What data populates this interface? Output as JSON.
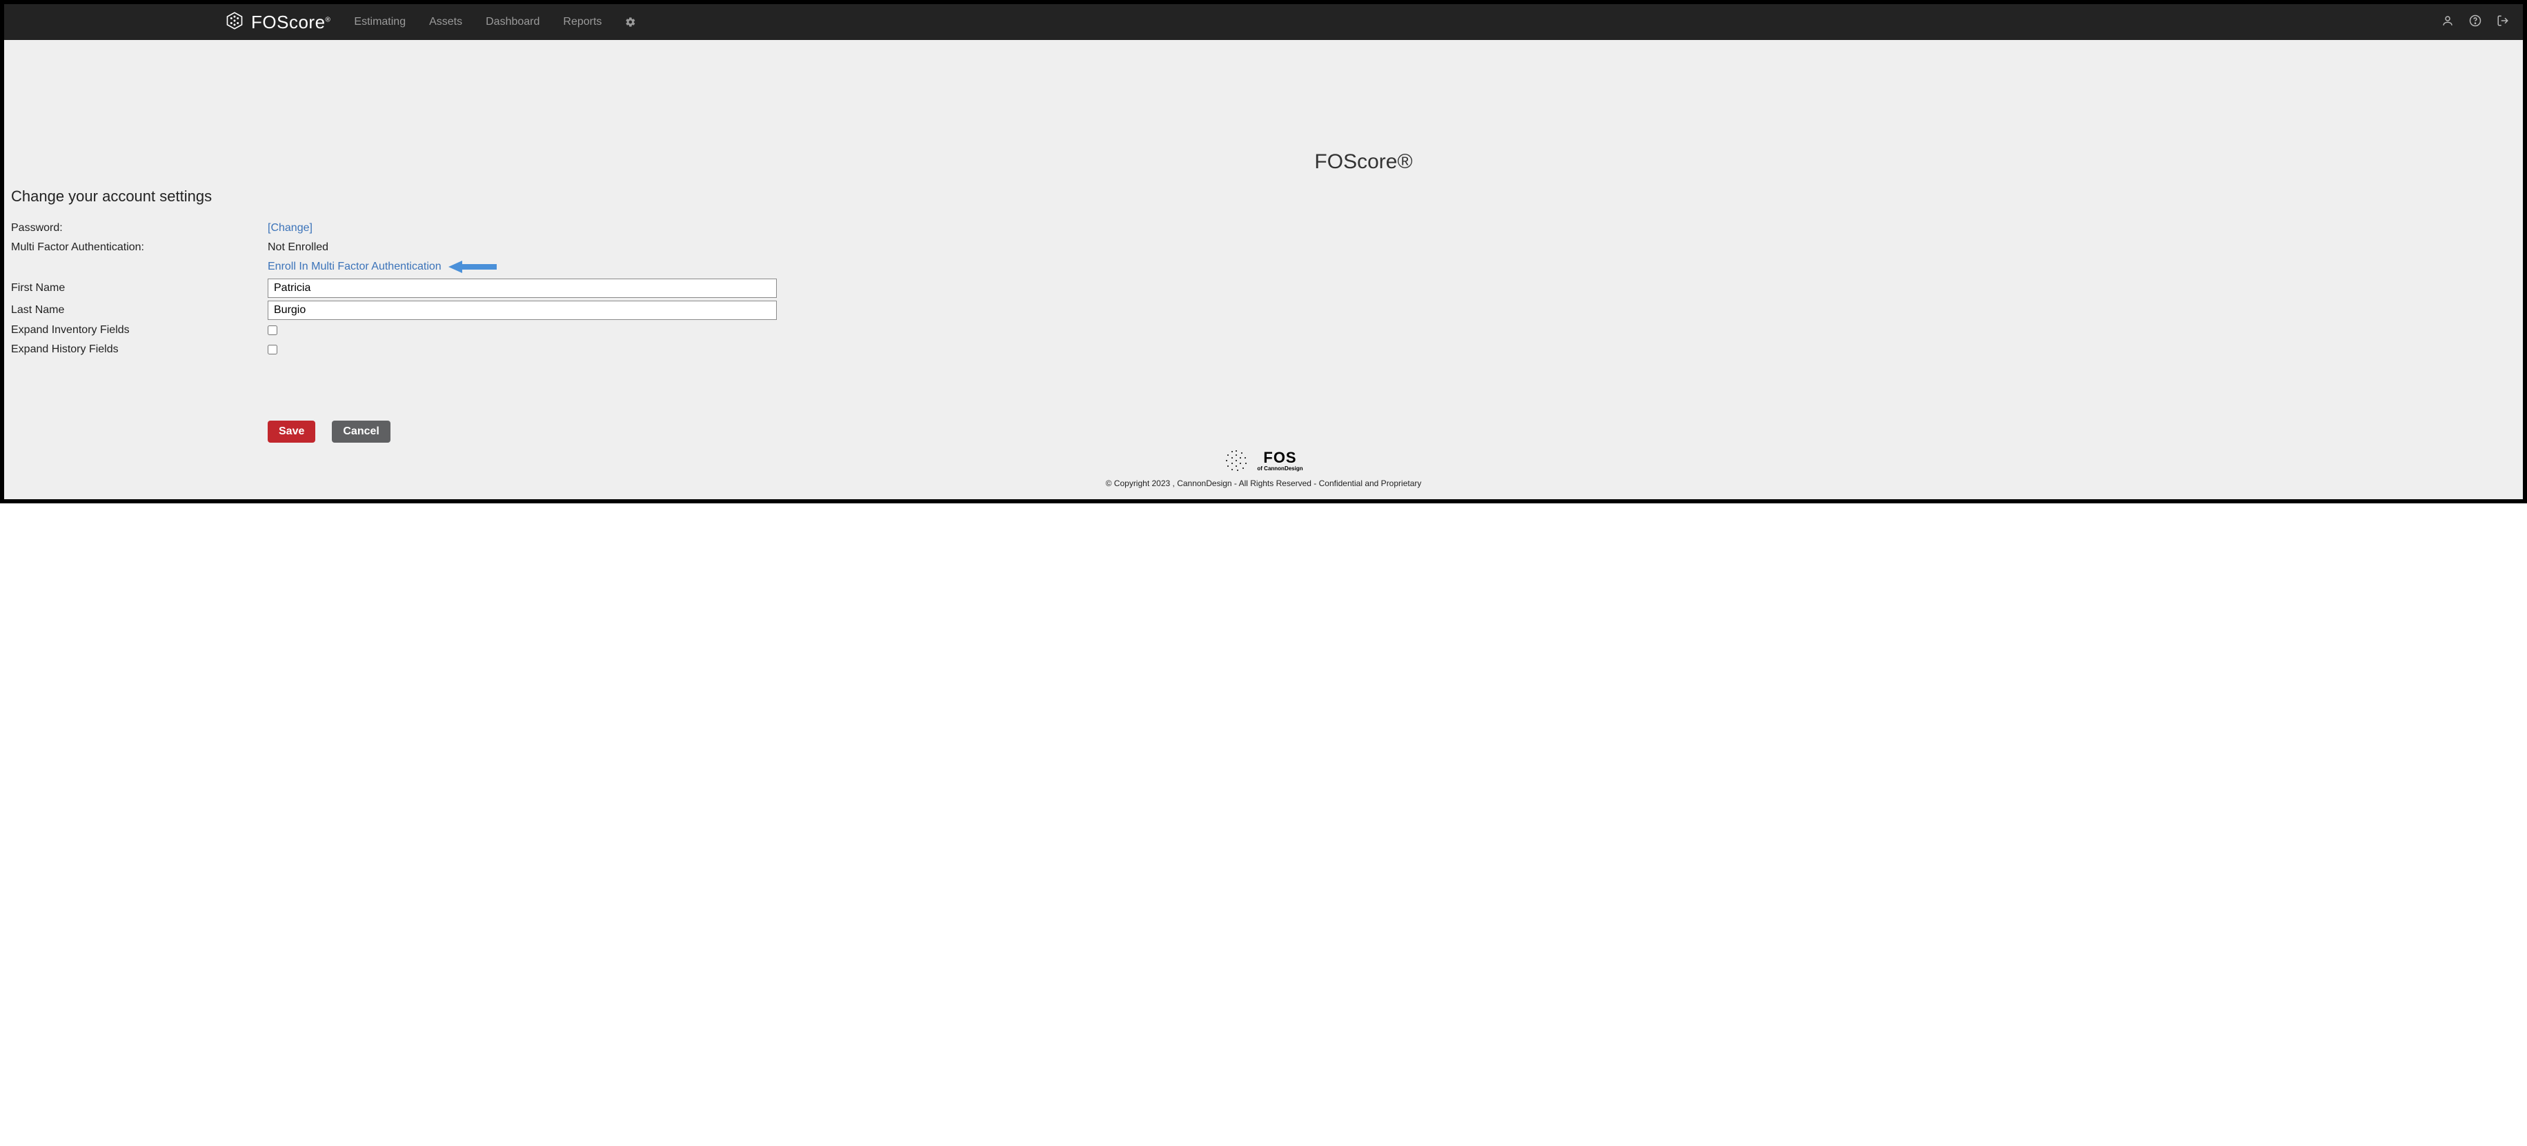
{
  "brand": "FOScore",
  "brand_suffix": "®",
  "nav": {
    "estimating": "Estimating",
    "assets": "Assets",
    "dashboard": "Dashboard",
    "reports": "Reports"
  },
  "page_title": "FOScore®",
  "section_title": "Change your account settings",
  "labels": {
    "password": "Password:",
    "mfa": "Multi Factor Authentication:",
    "first_name": "First Name",
    "last_name": "Last Name",
    "expand_inventory": "Expand Inventory Fields",
    "expand_history": "Expand History Fields"
  },
  "values": {
    "change_link": "[Change]",
    "mfa_status": "Not Enrolled",
    "mfa_enroll_link": "Enroll In Multi Factor Authentication",
    "first_name": "Patricia",
    "last_name": "Burgio",
    "expand_inventory": false,
    "expand_history": false
  },
  "buttons": {
    "save": "Save",
    "cancel": "Cancel"
  },
  "footer": {
    "logo_text": "FOS",
    "logo_sub": "of CannonDesign",
    "copyright": "© Copyright 2023 , CannonDesign - All Rights Reserved - Confidential and Proprietary"
  }
}
